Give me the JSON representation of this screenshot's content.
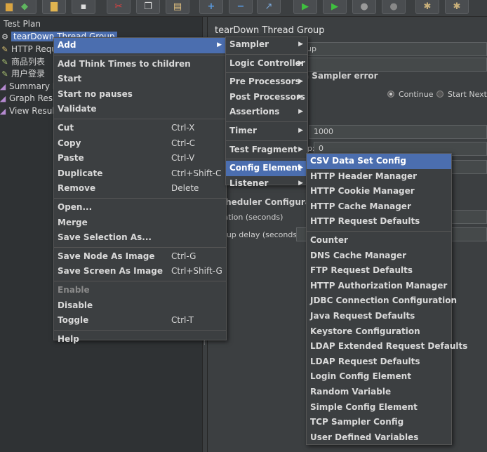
{
  "toolbar": {
    "buttons": [
      {
        "icon": "folder-icon",
        "glyph": "▆"
      },
      {
        "icon": "templates-icon",
        "glyph": "◆"
      },
      {
        "icon": "open-icon",
        "glyph": "▇"
      },
      {
        "icon": "save-icon",
        "glyph": "▪"
      },
      {
        "icon": "cut-icon",
        "glyph": "✂"
      },
      {
        "icon": "copy-icon",
        "glyph": "❐"
      },
      {
        "icon": "paste-icon",
        "glyph": "▤"
      },
      {
        "icon": "expand-icon",
        "glyph": "+"
      },
      {
        "icon": "collapse-icon",
        "glyph": "−"
      },
      {
        "icon": "toggle-icon",
        "glyph": "↗"
      },
      {
        "icon": "start-icon",
        "glyph": "▶"
      },
      {
        "icon": "start-no-pause-icon",
        "glyph": "▶"
      },
      {
        "icon": "stop-icon",
        "glyph": "●"
      },
      {
        "icon": "shutdown-icon",
        "glyph": "●"
      },
      {
        "icon": "clear-icon",
        "glyph": "✱"
      },
      {
        "icon": "clear-all-icon",
        "glyph": "✱"
      }
    ]
  },
  "tree": {
    "root": "Test Plan",
    "selected": "tearDown Thread Group",
    "children": [
      "HTTP Requ",
      "商品列表",
      "用户登录",
      "Summary Re",
      "Graph Resul",
      "View Results"
    ]
  },
  "right_panel": {
    "title": "tearDown Thread Group",
    "name_value": "up",
    "on_error_label": "a Sampler error",
    "continue_label": "Continue",
    "start_next_label": "Start Next T",
    "ramp_value": "1000",
    "loop_label": "p:",
    "loop_value": "0",
    "scheduler_label": "cheduler Configurati",
    "duration_label": "ration (seconds)",
    "startup_label": "rtup delay (seconds)"
  },
  "menu_main": {
    "add": "Add",
    "add_think_times": "Add Think Times to children",
    "start": "Start",
    "start_no_pauses": "Start no pauses",
    "validate": "Validate",
    "cut": "Cut",
    "cut_sc": "Ctrl-X",
    "copy": "Copy",
    "copy_sc": "Ctrl-C",
    "paste": "Paste",
    "paste_sc": "Ctrl-V",
    "duplicate": "Duplicate",
    "duplicate_sc": "Ctrl+Shift-C",
    "remove": "Remove",
    "remove_sc": "Delete",
    "open": "Open...",
    "merge": "Merge",
    "save_selection": "Save Selection As...",
    "save_node_image": "Save Node As Image",
    "save_node_image_sc": "Ctrl-G",
    "save_screen_image": "Save Screen As Image",
    "save_screen_image_sc": "Ctrl+Shift-G",
    "enable": "Enable",
    "disable": "Disable",
    "toggle": "Toggle",
    "toggle_sc": "Ctrl-T",
    "help": "Help"
  },
  "menu_add": [
    "Sampler",
    "Logic Controller",
    "Pre Processors",
    "Post Processors",
    "Assertions",
    "Timer",
    "Test Fragment",
    "Config Element",
    "Listener"
  ],
  "menu_config": {
    "group1": [
      "CSV Data Set Config",
      "HTTP Header Manager",
      "HTTP Cookie Manager",
      "HTTP Cache Manager",
      "HTTP Request Defaults"
    ],
    "group2": [
      "Counter",
      "DNS Cache Manager",
      "FTP Request Defaults",
      "HTTP Authorization Manager",
      "JDBC Connection Configuration",
      "Java Request Defaults",
      "Keystore Configuration",
      "LDAP Extended Request Defaults",
      "LDAP Request Defaults",
      "Login Config Element",
      "Random Variable",
      "Simple Config Element",
      "TCP Sampler Config",
      "User Defined Variables"
    ]
  },
  "colors": {
    "highlight": "#4b6eaf",
    "menu_bg": "#3c3f41"
  }
}
